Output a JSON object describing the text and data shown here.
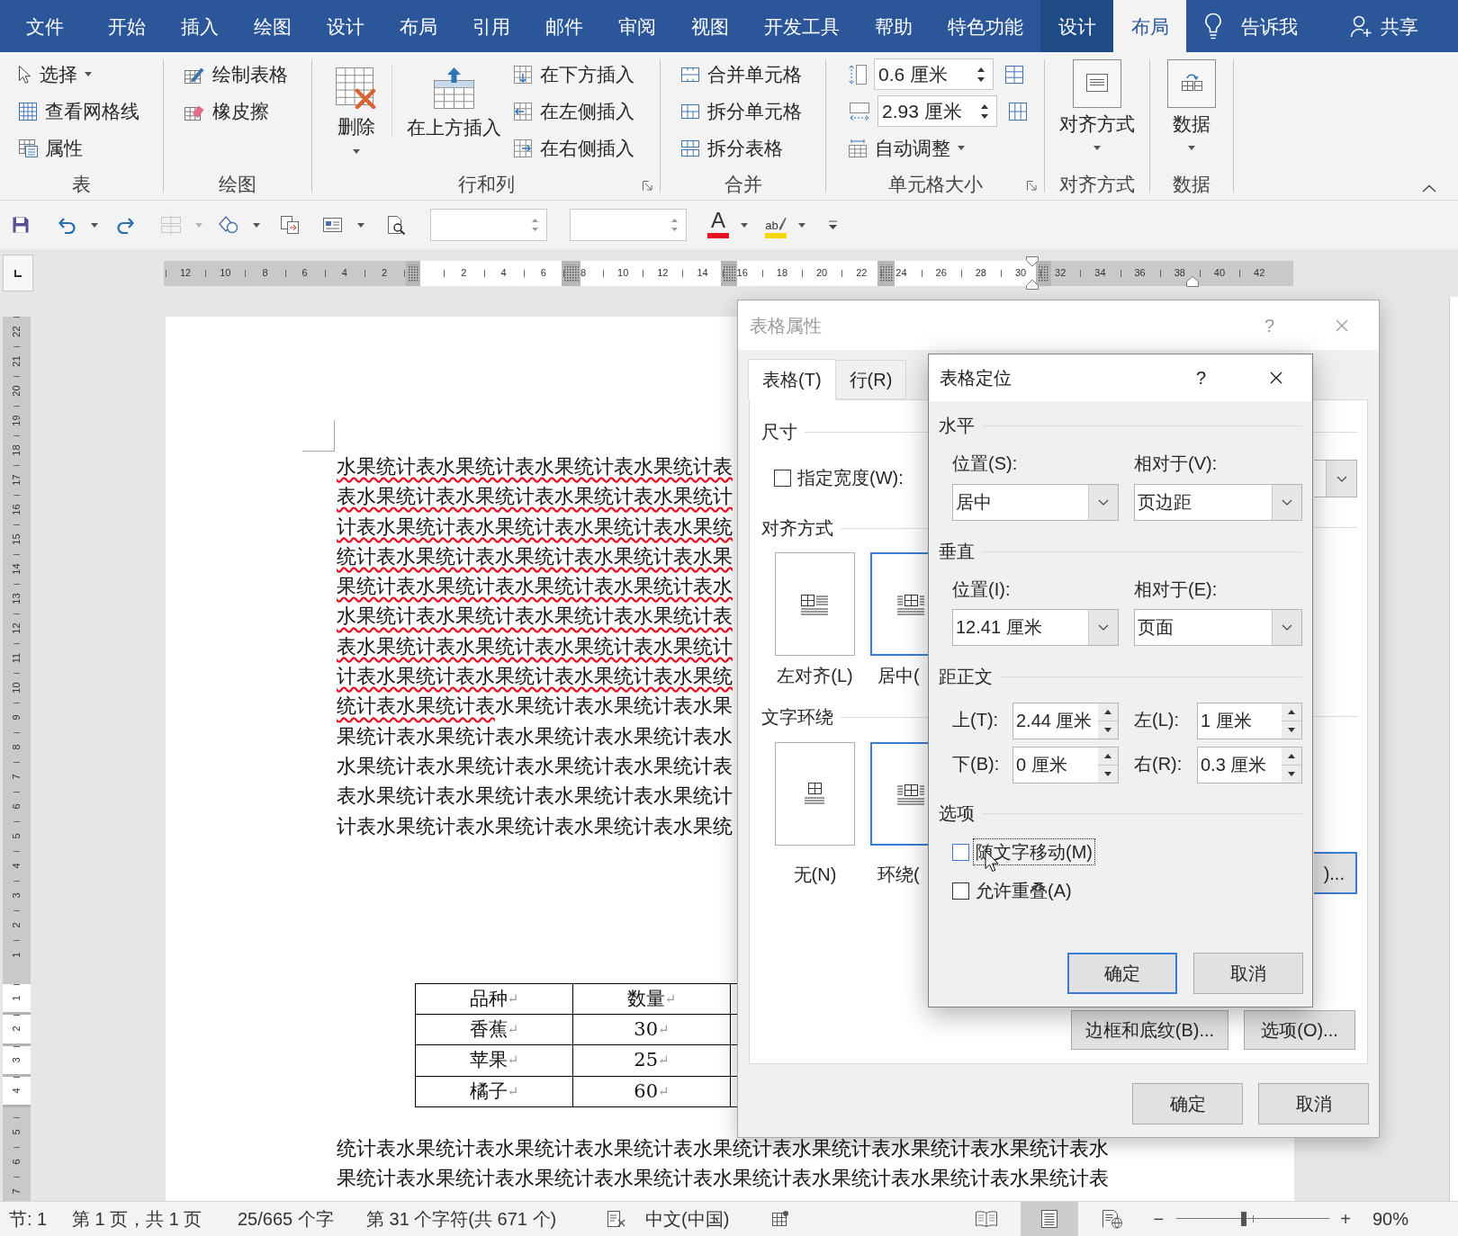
{
  "menu_tabs": [
    {
      "label": "文件",
      "kind": "file",
      "selected": false
    },
    {
      "label": "开始",
      "kind": "plain",
      "selected": false
    },
    {
      "label": "插入",
      "kind": "plain",
      "selected": false
    },
    {
      "label": "绘图",
      "kind": "plain",
      "selected": false
    },
    {
      "label": "设计",
      "kind": "plain",
      "selected": false
    },
    {
      "label": "布局",
      "kind": "plain",
      "selected": false
    },
    {
      "label": "引用",
      "kind": "plain",
      "selected": false
    },
    {
      "label": "邮件",
      "kind": "plain",
      "selected": false
    },
    {
      "label": "审阅",
      "kind": "plain",
      "selected": false
    },
    {
      "label": "视图",
      "kind": "plain",
      "selected": false
    },
    {
      "label": "开发工具",
      "kind": "plain",
      "selected": false
    },
    {
      "label": "帮助",
      "kind": "plain",
      "selected": false
    },
    {
      "label": "特色功能",
      "kind": "plain",
      "selected": false
    },
    {
      "label": "设计",
      "kind": "contextual",
      "selected": false
    },
    {
      "label": "布局",
      "kind": "contextual",
      "selected": true
    }
  ],
  "tell_me": {
    "label": "告诉我"
  },
  "share": {
    "label": "共享"
  },
  "ribbon": {
    "groups": [
      {
        "label": "表",
        "launcher": false,
        "items": [
          {
            "kind": "small",
            "label": "选择",
            "dropdown": true
          },
          {
            "kind": "small",
            "label": "查看网格线",
            "dropdown": false
          },
          {
            "kind": "small",
            "label": "属性",
            "dropdown": false
          }
        ]
      },
      {
        "label": "绘图",
        "launcher": false,
        "items": [
          {
            "kind": "small",
            "label": "绘制表格",
            "dropdown": false
          },
          {
            "kind": "small",
            "label": "橡皮擦",
            "dropdown": false
          }
        ]
      },
      {
        "label": "行和列",
        "launcher": true,
        "items": [
          {
            "kind": "large",
            "label": "删除",
            "dropdown": true
          },
          {
            "kind": "large",
            "label": "在上方插入",
            "dropdown": false
          },
          {
            "kind": "small",
            "label": "在下方插入",
            "dropdown": false
          },
          {
            "kind": "small",
            "label": "在左侧插入",
            "dropdown": false
          },
          {
            "kind": "small",
            "label": "在右侧插入",
            "dropdown": false
          }
        ]
      },
      {
        "label": "合并",
        "launcher": false,
        "items": [
          {
            "kind": "small",
            "label": "合并单元格",
            "dropdown": false
          },
          {
            "kind": "small",
            "label": "拆分单元格",
            "dropdown": false
          },
          {
            "kind": "small",
            "label": "拆分表格",
            "dropdown": false
          }
        ]
      },
      {
        "label": "单元格大小",
        "launcher": true,
        "items": [
          {
            "kind": "field",
            "value": "0.6 厘米"
          },
          {
            "kind": "field",
            "value": "2.93 厘米"
          },
          {
            "kind": "small",
            "label": "自动调整",
            "dropdown": true
          }
        ]
      },
      {
        "label": "对齐方式",
        "launcher": false,
        "items": [
          {
            "kind": "boxed",
            "label": "对齐方式",
            "dropdown": true
          }
        ]
      },
      {
        "label": "数据",
        "launcher": false,
        "items": [
          {
            "kind": "boxed",
            "label": "数据",
            "dropdown": true
          }
        ]
      }
    ]
  },
  "quick_access": [
    {
      "kind": "button",
      "dropdown": false,
      "disabled": false
    },
    {
      "kind": "button",
      "dropdown": true,
      "disabled": false
    },
    {
      "kind": "button",
      "dropdown": false,
      "disabled": false
    },
    {
      "kind": "button",
      "dropdown": true,
      "disabled": true
    },
    {
      "kind": "button",
      "dropdown": true,
      "disabled": false
    },
    {
      "kind": "button",
      "dropdown": false,
      "disabled": false
    },
    {
      "kind": "button",
      "dropdown": true,
      "disabled": false
    },
    {
      "kind": "button",
      "dropdown": false,
      "disabled": false
    },
    {
      "kind": "field"
    },
    {
      "kind": "field"
    },
    {
      "kind": "glyph",
      "glyph": "A",
      "color": "#e81123",
      "dropdown": true
    },
    {
      "kind": "glyph",
      "glyph": "ab",
      "color": "#f5d800",
      "dropdown": true
    },
    {
      "kind": "customize"
    }
  ],
  "ruler": {
    "left_labels": [
      "12",
      "10",
      "8",
      "6",
      "4",
      "2"
    ],
    "right_labels": [
      "2",
      "4",
      "6",
      "8",
      "10",
      "12",
      "14",
      "16",
      "18",
      "20",
      "22",
      "24",
      "26",
      "28",
      "30",
      "32",
      "34",
      "36",
      "38",
      "40",
      "42"
    ]
  },
  "vertical_ruler": {
    "top_labels": [
      "22",
      "21",
      "20",
      "19",
      "18",
      "17",
      "16",
      "15",
      "14",
      "13",
      "12",
      "11",
      "10",
      "9",
      "8",
      "7",
      "6",
      "5",
      "4",
      "3",
      "2",
      "1"
    ],
    "table_labels": [
      "1",
      "2",
      "3",
      "4"
    ],
    "bottom_labels": [
      "5",
      "6",
      "7"
    ]
  },
  "document": {
    "lines_before_table": [
      {
        "runs": [
          {
            "text": "水果统计表水果统计表水果统计表水果统计表",
            "flagged": true
          }
        ]
      },
      {
        "runs": [
          {
            "text": "表水果统计表水果统计表水果统计表水果统计",
            "flagged": true
          }
        ]
      },
      {
        "runs": [
          {
            "text": "计表水果统计表水果统计表水果统计表水果统",
            "flagged": true
          }
        ]
      },
      {
        "runs": [
          {
            "text": "统计表水果统计表水果统计表水果统计表水果",
            "flagged": true
          }
        ]
      },
      {
        "runs": [
          {
            "text": "果统计表水果统计表水果统计表水果统计表水",
            "flagged": true
          }
        ]
      },
      {
        "runs": [
          {
            "text": "水果统计表水果统计表水果统计表水果统计表",
            "flagged": true
          }
        ]
      },
      {
        "runs": [
          {
            "text": "表水果统计表水果统计表水果统计表水果统计",
            "flagged": true
          }
        ]
      },
      {
        "runs": [
          {
            "text": "计表水果统计表水果统计表水果统计表水果统",
            "flagged": true
          }
        ]
      },
      {
        "runs": [
          {
            "text": "统计表水果统计表",
            "flagged": true
          },
          {
            "text": "水果统计表水果统计表水果",
            "flagged": false
          }
        ]
      },
      {
        "runs": [
          {
            "text": "果统计表水果统计表水果统计表水果统计表水",
            "flagged": false
          }
        ]
      },
      {
        "runs": [
          {
            "text": "水果统计表水果统计表水果统计表水果统计表",
            "flagged": false
          }
        ]
      },
      {
        "runs": [
          {
            "text": "表水果统计表水果统计表水果统计表水果统计",
            "flagged": false
          }
        ]
      },
      {
        "runs": [
          {
            "text": "计表水果统计表水果统计表水果统计表水果统",
            "flagged": false
          }
        ]
      }
    ],
    "table": {
      "rows": [
        [
          {
            "text": "品种",
            "mark": "↵"
          },
          {
            "text": "数量",
            "mark": "↵"
          }
        ],
        [
          {
            "text": "香蕉",
            "mark": "↵"
          },
          {
            "text": "30",
            "mark": "↵"
          }
        ],
        [
          {
            "text": "苹果",
            "mark": "↵"
          },
          {
            "text": "25",
            "mark": "↵"
          }
        ],
        [
          {
            "text": "橘子",
            "mark": "↵"
          },
          {
            "text": "60",
            "mark": "↵"
          }
        ]
      ]
    },
    "lines_after_table": [
      {
        "runs": [
          {
            "text": "统计表水果统计表水果统计表水果统计表水果统计表水果统计表水果统计表水果统计表水",
            "flagged": false
          }
        ]
      },
      {
        "runs": [
          {
            "text": "果统计表水果统计表水果统计表水果统计表水果统计表水果统计表水果统计表水果统计表",
            "flagged": false
          }
        ]
      }
    ]
  },
  "table_properties_dialog": {
    "title": "表格属性",
    "help": "?",
    "active": false,
    "tabs": [
      {
        "label": "表格(T)",
        "selected": true
      },
      {
        "label": "行(R)",
        "selected": false
      }
    ],
    "size": {
      "heading": "尺寸",
      "width_checkbox": {
        "label": "指定宽度(W):",
        "checked": false
      }
    },
    "alignment": {
      "heading": "对齐方式",
      "options": [
        {
          "label": "左对齐(L)",
          "selected": false
        },
        {
          "label": "居中(",
          "selected": true
        }
      ]
    },
    "text_wrapping": {
      "heading": "文字环绕",
      "options": [
        {
          "label": "无(N)",
          "selected": false
        },
        {
          "label": "环绕(",
          "selected": true
        }
      ]
    },
    "positioning_button": {
      "label": ")...",
      "focused": true
    },
    "buttons": [
      {
        "label": "边框和底纹(B)..."
      },
      {
        "label": "选项(O)..."
      }
    ],
    "footer_buttons": [
      {
        "label": "确定",
        "default": false
      },
      {
        "label": "取消",
        "default": false
      }
    ]
  },
  "table_positioning_dialog": {
    "title": "表格定位",
    "help": "?",
    "active": true,
    "horizontal": {
      "heading": "水平",
      "position": {
        "label": "位置(S):",
        "value": "居中"
      },
      "relative_to": {
        "label": "相对于(V):",
        "value": "页边距"
      }
    },
    "vertical": {
      "heading": "垂直",
      "position": {
        "label": "位置(I):",
        "value": "12.41 厘米"
      },
      "relative_to": {
        "label": "相对于(E):",
        "value": "页面"
      }
    },
    "distance": {
      "heading": "距正文",
      "fields": [
        {
          "label": "上(T):",
          "value": "2.44 厘米"
        },
        {
          "label": "左(L):",
          "value": "1 厘米"
        },
        {
          "label": "下(B):",
          "value": "0 厘米"
        },
        {
          "label": "右(R):",
          "value": "0.3 厘米"
        }
      ]
    },
    "options": {
      "heading": "选项",
      "checkboxes": [
        {
          "label": "随文字移动(M)",
          "checked": false,
          "focused": true
        },
        {
          "label": "允许重叠(A)",
          "checked": false,
          "focused": false
        }
      ]
    },
    "buttons": [
      {
        "label": "确定",
        "default": true
      },
      {
        "label": "取消",
        "default": false
      }
    ]
  },
  "status_bar": {
    "section": "节: 1",
    "pages": "第 1 页，共 1 页",
    "words": "25/665 个字",
    "characters": "第 31 个字符(共 671 个)",
    "language": "中文(中国)",
    "views": [
      {
        "selected": false
      },
      {
        "selected": true
      },
      {
        "selected": false
      }
    ],
    "zoom": {
      "minus": "−",
      "plus": "+",
      "level": 0.44,
      "percent": "90%"
    }
  }
}
